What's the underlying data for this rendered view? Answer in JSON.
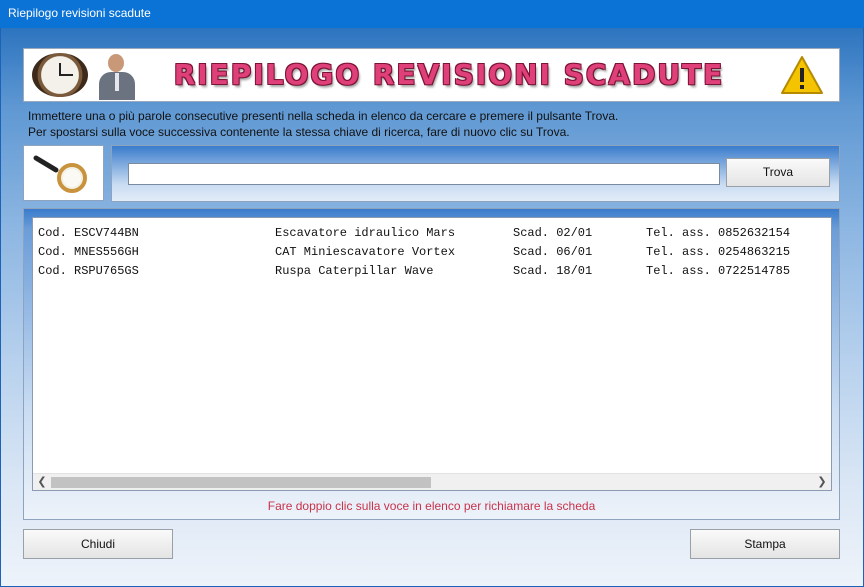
{
  "window": {
    "title": "Riepilogo revisioni scadute"
  },
  "banner": {
    "title": "RIEPILOGO REVISIONI SCADUTE",
    "left_icons": [
      "clock-icon",
      "businessman-phone-icon"
    ],
    "right_icon": "warning-icon"
  },
  "instructions": {
    "line1": "Immettere una o più parole consecutive presenti nella scheda in elenco da cercare e premere il pulsante Trova.",
    "line2": "Per spostarsi sulla voce successiva contenente la stessa chiave di ricerca, fare di nuovo clic su Trova."
  },
  "search": {
    "icon": "magnifier-icon",
    "value": "",
    "button_label": "Trova"
  },
  "list": {
    "items": [
      {
        "code": "Cod. ESCV744BN",
        "description": "Escavatore idraulico Mars",
        "due": "Scad. 02/01",
        "phone": "Tel. ass. 0852632154"
      },
      {
        "code": "Cod. MNES556GH",
        "description": "CAT Miniescavatore Vortex",
        "due": "Scad. 06/01",
        "phone": "Tel. ass. 0254863215"
      },
      {
        "code": "Cod. RSPU765GS",
        "description": "Ruspa Caterpillar Wave",
        "due": "Scad. 18/01",
        "phone": "Tel. ass. 0722514785"
      }
    ],
    "hint": "Fare doppio clic sulla voce in elenco per richiamare la scheda"
  },
  "footer": {
    "close_label": "Chiudi",
    "print_label": "Stampa"
  },
  "colors": {
    "titlebar": "#0b73d6",
    "banner_title": "#e0407a",
    "hint": "#c8334a"
  }
}
